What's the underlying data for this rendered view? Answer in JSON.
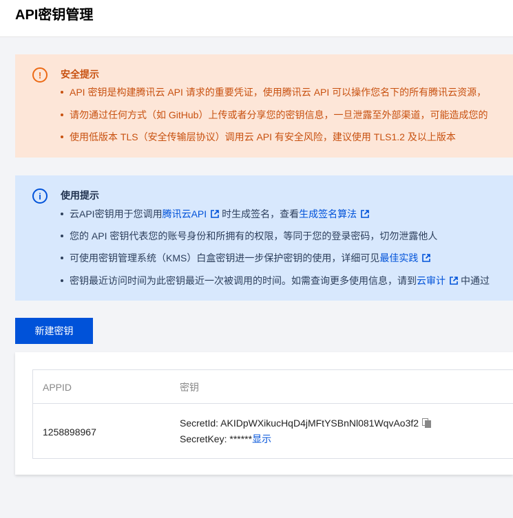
{
  "page": {
    "title": "API密钥管理"
  },
  "security_notice": {
    "icon": "warning-circle-icon",
    "title": "安全提示",
    "items": [
      "API 密钥是构建腾讯云 API 请求的重要凭证，使用腾讯云 API 可以操作您名下的所有腾讯云资源，",
      "请勿通过任何方式（如 GitHub）上传或者分享您的密钥信息，一旦泄露至外部渠道，可能造成您的",
      "使用低版本 TLS（安全传输层协议）调用云 API 有安全风险，建议使用 TLS1.2 及以上版本"
    ]
  },
  "usage_notice": {
    "icon": "info-circle-icon",
    "title": "使用提示",
    "item1": {
      "prefix": "云API密钥用于您调用",
      "link1": "腾讯云API",
      "middle": "时生成签名，查看",
      "link2": "生成签名算法"
    },
    "item2": {
      "text": "您的 API 密钥代表您的账号身份和所拥有的权限，等同于您的登录密码，切勿泄露他人"
    },
    "item3": {
      "prefix": "可使用密钥管理系统（KMS）白盒密钥进一步保护密钥的使用，详细可见",
      "link": "最佳实践"
    },
    "item4": {
      "prefix": "密钥最近访问时间为此密钥最近一次被调用的时间。如需查询更多使用信息，请到",
      "link": "云审计",
      "suffix": "中通过"
    }
  },
  "actions": {
    "create_key_label": "新建密钥"
  },
  "table": {
    "columns": {
      "appid": "APPID",
      "key": "密钥"
    },
    "rows": [
      {
        "appid": "1258898967",
        "secret_id_label": "SecretId:",
        "secret_id": "AKIDpWXikucHqD4jMFtYSBnNl081WqvAo3f2",
        "secret_key_label": "SecretKey:",
        "secret_key": "******",
        "show_label": "显示"
      }
    ]
  },
  "colors": {
    "primary": "#0052d9",
    "warning_bg": "#fde6d8",
    "warning_text": "#c85110",
    "info_bg": "#d8e8fd"
  }
}
